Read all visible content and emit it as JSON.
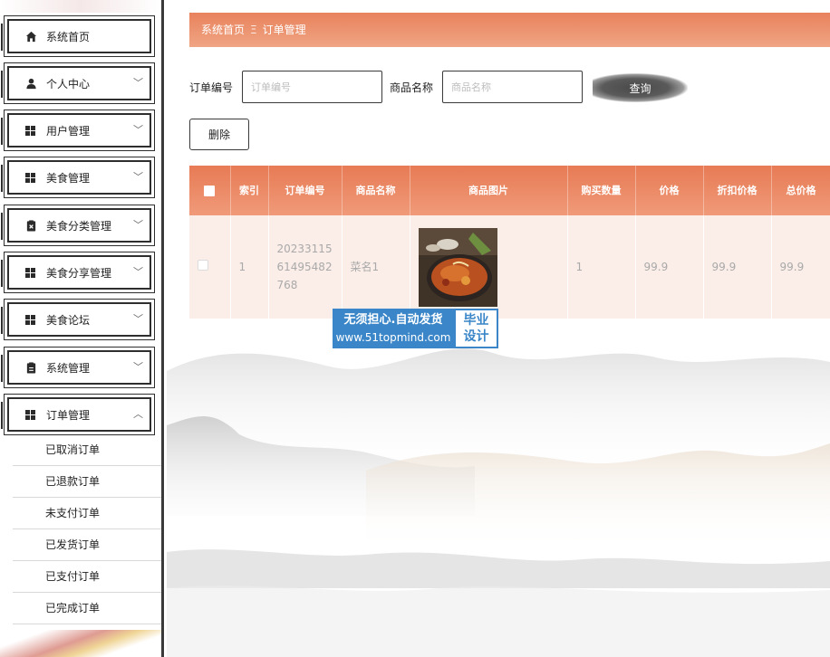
{
  "sidebar": {
    "items": [
      {
        "label": "系统首页",
        "icon": "home-icon"
      },
      {
        "label": "个人中心",
        "icon": "person-icon"
      },
      {
        "label": "用户管理",
        "icon": "grid-icon"
      },
      {
        "label": "美食管理",
        "icon": "grid-icon"
      },
      {
        "label": "美食分类管理",
        "icon": "clipboard-x-icon"
      },
      {
        "label": "美食分享管理",
        "icon": "grid-icon"
      },
      {
        "label": "美食论坛",
        "icon": "grid-icon"
      },
      {
        "label": "系统管理",
        "icon": "clipboard-icon"
      },
      {
        "label": "订单管理",
        "icon": "grid-icon"
      }
    ],
    "submenu": [
      {
        "label": "已取消订单"
      },
      {
        "label": "已退款订单"
      },
      {
        "label": "未支付订单"
      },
      {
        "label": "已发货订单"
      },
      {
        "label": "已支付订单"
      },
      {
        "label": "已完成订单"
      }
    ]
  },
  "breadcrumb": {
    "home": "系统首页",
    "separator": "Ξ",
    "current": "订单管理"
  },
  "search": {
    "order_no_label": "订单编号",
    "order_no_placeholder": "订单编号",
    "product_name_label": "商品名称",
    "product_name_placeholder": "商品名称",
    "query_label": "查询"
  },
  "actions": {
    "delete_label": "删除"
  },
  "table": {
    "headers": {
      "index": "索引",
      "order_no": "订单编号",
      "product_name": "商品名称",
      "product_image": "商品图片",
      "quantity": "购买数量",
      "price": "价格",
      "discount_price": "折扣价格",
      "total_price": "总价格"
    },
    "rows": [
      {
        "index": "1",
        "order_no": "2023311561495482768",
        "product_name": "菜名1",
        "quantity": "1",
        "price": "99.9",
        "discount_price": "99.9",
        "total_price": "99.9"
      }
    ]
  },
  "watermark": {
    "line1": "无须担心.自动发货",
    "line2": "www.51topmind.com",
    "badge_top": "毕业",
    "badge_bottom": "设计"
  },
  "colors": {
    "accent": "#e8825c",
    "row_bg": "#fbeee9",
    "watermark_blue": "#3a86c8"
  }
}
